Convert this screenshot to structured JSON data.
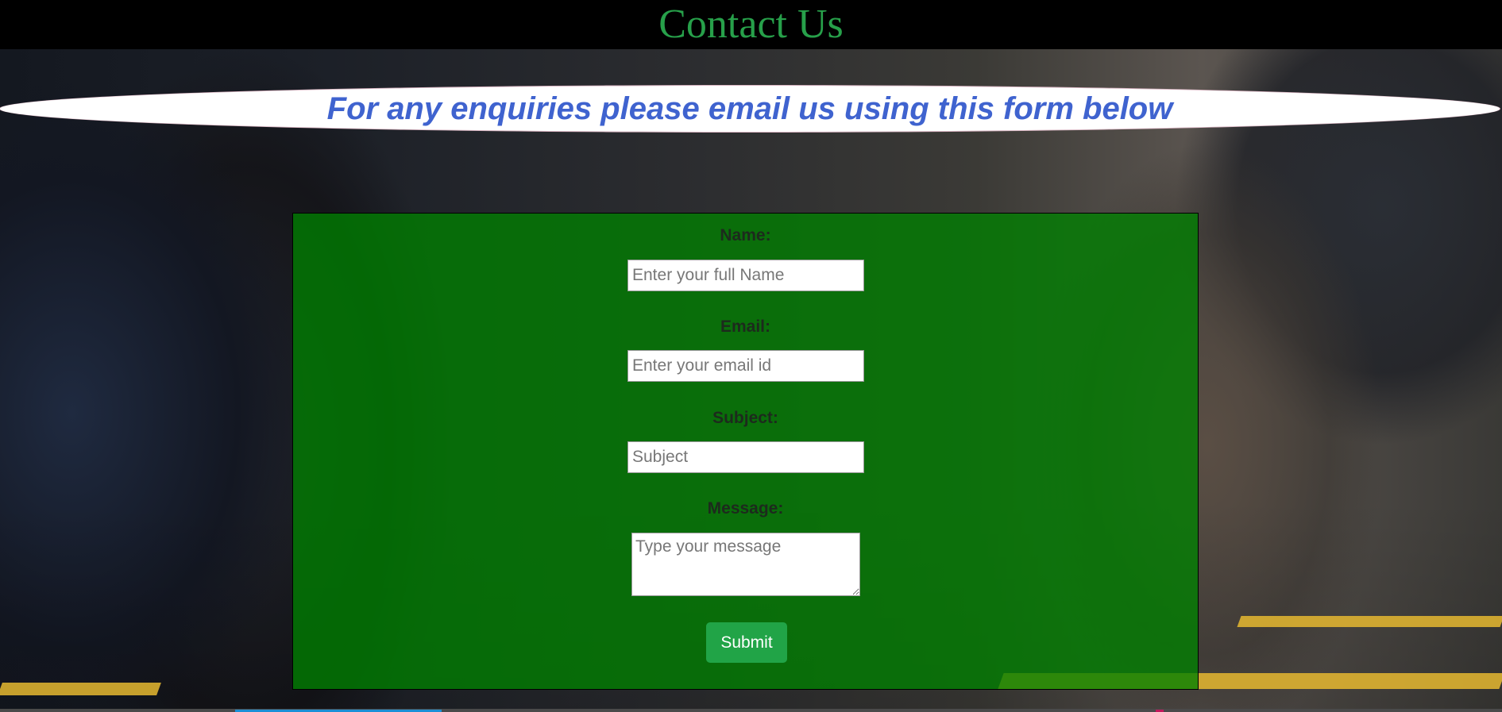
{
  "header": {
    "title": "Contact Us"
  },
  "banner": {
    "text": "For any enquiries please email us using this form below"
  },
  "form": {
    "name_label": "Name:",
    "name_placeholder": "Enter your full Name",
    "email_label": "Email:",
    "email_placeholder": "Enter your email id",
    "subject_label": "Subject:",
    "subject_placeholder": "Subject",
    "message_label": "Message:",
    "message_placeholder": "Type your message",
    "submit_label": "Submit"
  },
  "colors": {
    "title": "#27a04a",
    "banner_text": "#3f63cf",
    "panel": "#008000",
    "submit": "#21a447"
  }
}
